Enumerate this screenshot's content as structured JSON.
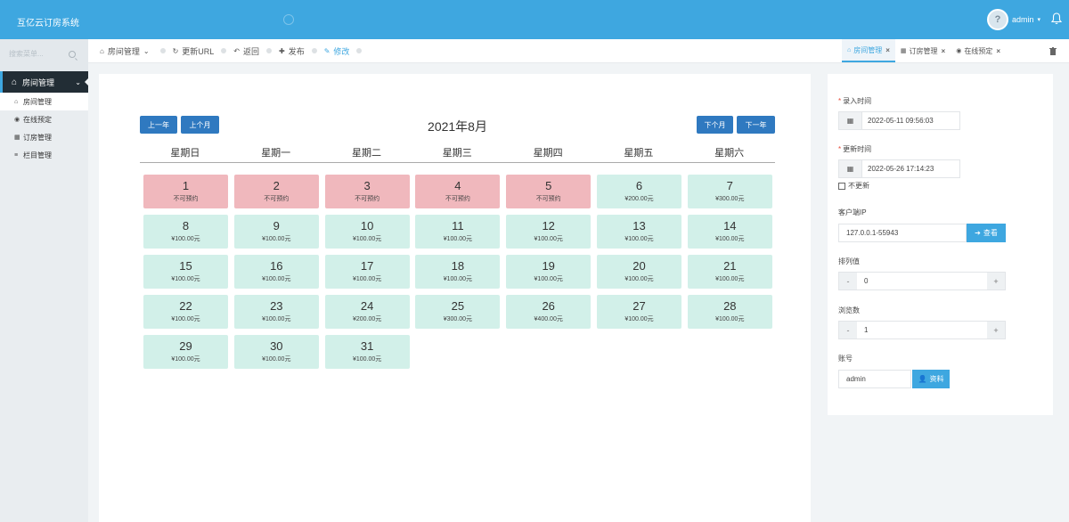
{
  "app": {
    "title": "互亿云订房系统",
    "user": "admin",
    "avatar_char": "?"
  },
  "sidebar": {
    "search_placeholder": "搜索菜单...",
    "main_item": "房间管理",
    "items": [
      {
        "label": "房间管理",
        "icon": "home-icon"
      },
      {
        "label": "在线预定",
        "icon": "eye-icon"
      },
      {
        "label": "订房管理",
        "icon": "table-icon"
      },
      {
        "label": "栏目管理",
        "icon": "list-icon"
      }
    ]
  },
  "toolbar": {
    "breadcrumb": "房间管理",
    "refresh": "更新URL",
    "back": "返回",
    "publish": "发布",
    "edit": "修改"
  },
  "tabs": [
    {
      "label": "房间管理",
      "active": true
    },
    {
      "label": "订房管理",
      "active": false
    },
    {
      "label": "在线预定",
      "active": false
    }
  ],
  "calendar": {
    "title": "2021年8月",
    "prev_year": "上一年",
    "prev_month": "上个月",
    "next_month": "下个月",
    "next_year": "下一年",
    "weekdays": [
      "星期日",
      "星期一",
      "星期二",
      "星期三",
      "星期四",
      "星期五",
      "星期六"
    ],
    "days": [
      {
        "day": "1",
        "label": "不可预约",
        "status": "unavailable"
      },
      {
        "day": "2",
        "label": "不可预约",
        "status": "unavailable"
      },
      {
        "day": "3",
        "label": "不可预约",
        "status": "unavailable"
      },
      {
        "day": "4",
        "label": "不可预约",
        "status": "unavailable"
      },
      {
        "day": "5",
        "label": "不可预约",
        "status": "unavailable"
      },
      {
        "day": "6",
        "label": "¥200.00元",
        "status": "available"
      },
      {
        "day": "7",
        "label": "¥300.00元",
        "status": "available"
      },
      {
        "day": "8",
        "label": "¥100.00元",
        "status": "available"
      },
      {
        "day": "9",
        "label": "¥100.00元",
        "status": "available"
      },
      {
        "day": "10",
        "label": "¥100.00元",
        "status": "available"
      },
      {
        "day": "11",
        "label": "¥100.00元",
        "status": "available"
      },
      {
        "day": "12",
        "label": "¥100.00元",
        "status": "available"
      },
      {
        "day": "13",
        "label": "¥100.00元",
        "status": "available"
      },
      {
        "day": "14",
        "label": "¥100.00元",
        "status": "available"
      },
      {
        "day": "15",
        "label": "¥100.00元",
        "status": "available"
      },
      {
        "day": "16",
        "label": "¥100.00元",
        "status": "available"
      },
      {
        "day": "17",
        "label": "¥100.00元",
        "status": "available"
      },
      {
        "day": "18",
        "label": "¥100.00元",
        "status": "available"
      },
      {
        "day": "19",
        "label": "¥100.00元",
        "status": "available"
      },
      {
        "day": "20",
        "label": "¥100.00元",
        "status": "available"
      },
      {
        "day": "21",
        "label": "¥100.00元",
        "status": "available"
      },
      {
        "day": "22",
        "label": "¥100.00元",
        "status": "available"
      },
      {
        "day": "23",
        "label": "¥100.00元",
        "status": "available"
      },
      {
        "day": "24",
        "label": "¥200.00元",
        "status": "available"
      },
      {
        "day": "25",
        "label": "¥300.00元",
        "status": "available"
      },
      {
        "day": "26",
        "label": "¥400.00元",
        "status": "available"
      },
      {
        "day": "27",
        "label": "¥100.00元",
        "status": "available"
      },
      {
        "day": "28",
        "label": "¥100.00元",
        "status": "available"
      },
      {
        "day": "29",
        "label": "¥100.00元",
        "status": "available"
      },
      {
        "day": "30",
        "label": "¥100.00元",
        "status": "available"
      },
      {
        "day": "31",
        "label": "¥100.00元",
        "status": "available"
      }
    ]
  },
  "form": {
    "created_label": "录入时间",
    "created_value": "2022-05-11 09:56:03",
    "updated_label": "更新时间",
    "updated_value": "2022-05-26 17:14:23",
    "no_update_label": "不更新",
    "ip_label": "客户端IP",
    "ip_value": "127.0.0.1-55943",
    "ip_button": "查看",
    "sort_label": "排列值",
    "sort_value": "0",
    "views_label": "浏览数",
    "views_value": "1",
    "account_label": "账号",
    "account_value": "admin",
    "account_button": "资料"
  },
  "colors": {
    "header": "#3ea7e0",
    "nav_button": "#2f79c0",
    "unavailable_day": "#f0b8bd",
    "available_day": "#d2f0e9"
  }
}
